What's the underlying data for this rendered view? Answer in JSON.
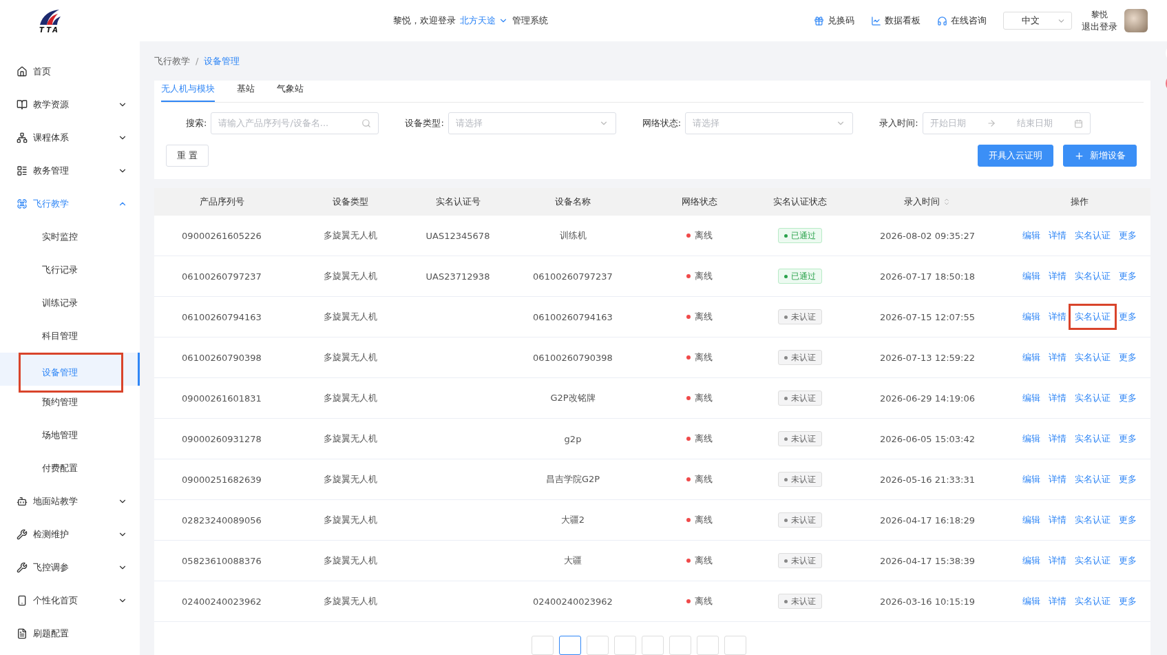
{
  "header": {
    "greeting": "黎悦，欢迎登录",
    "org": "北方天途",
    "system": "管理系统",
    "links": [
      {
        "kind": "gift",
        "label": "兑换码"
      },
      {
        "kind": "chart",
        "label": "数据看板"
      },
      {
        "kind": "headset",
        "label": "在线咨询"
      }
    ],
    "language": "中文",
    "user": "黎悦",
    "logout": "退出登录",
    "logo_text": "TTA"
  },
  "sidebar": [
    {
      "kind": "home",
      "label": "首页",
      "expandable": false,
      "expanded": false
    },
    {
      "kind": "book",
      "label": "教学资源",
      "expandable": true,
      "expanded": false
    },
    {
      "kind": "tree",
      "label": "课程体系",
      "expandable": true,
      "expanded": false
    },
    {
      "kind": "list",
      "label": "教务管理",
      "expandable": true,
      "expanded": false
    },
    {
      "kind": "drone",
      "label": "飞行教学",
      "expandable": true,
      "expanded": true,
      "children": [
        {
          "label": "实时监控",
          "selected": false,
          "highlighted": false
        },
        {
          "label": "飞行记录",
          "selected": false,
          "highlighted": false
        },
        {
          "label": "训练记录",
          "selected": false,
          "highlighted": false
        },
        {
          "label": "科目管理",
          "selected": false,
          "highlighted": false
        },
        {
          "label": "设备管理",
          "selected": true,
          "highlighted": true
        },
        {
          "label": "预约管理",
          "selected": false,
          "highlighted": false
        },
        {
          "label": "场地管理",
          "selected": false,
          "highlighted": false
        },
        {
          "label": "付费配置",
          "selected": false,
          "highlighted": false
        }
      ]
    },
    {
      "kind": "robot",
      "label": "地面站教学",
      "expandable": true,
      "expanded": false
    },
    {
      "kind": "tools",
      "label": "检测维护",
      "expandable": true,
      "expanded": false
    },
    {
      "kind": "tools",
      "label": "飞控调参",
      "expandable": true,
      "expanded": false
    },
    {
      "kind": "phone",
      "label": "个性化首页",
      "expandable": true,
      "expanded": false
    },
    {
      "kind": "doc",
      "label": "刷题配置",
      "expandable": false,
      "expanded": false
    }
  ],
  "breadcrumb": [
    "飞行教学",
    "设备管理"
  ],
  "breadcrumb_separator": "/",
  "tabs": [
    {
      "label": "无人机与模块",
      "selected": true
    },
    {
      "label": "基站",
      "selected": false
    },
    {
      "label": "气象站",
      "selected": false
    }
  ],
  "filters": [
    {
      "kind": "search",
      "label": "搜索:",
      "placeholder": "请输入产品序列号/设备名..."
    },
    {
      "kind": "select",
      "label": "设备类型:",
      "placeholder": "请选择"
    },
    {
      "kind": "select",
      "label": "网络状态:",
      "placeholder": "请选择"
    },
    {
      "kind": "daterange",
      "label": "录入时间:",
      "placeholder": "开始日期",
      "placeholder_end": "结束日期"
    }
  ],
  "reset_button": "重 置",
  "action_buttons": [
    {
      "kind": "plain",
      "label": "开具入云证明"
    },
    {
      "kind": "add",
      "label": "新增设备"
    }
  ],
  "table": {
    "columns": [
      {
        "label": "产品序列号",
        "sortable": false
      },
      {
        "label": "设备类型",
        "sortable": false
      },
      {
        "label": "实名认证号",
        "sortable": false
      },
      {
        "label": "设备名称",
        "sortable": false
      },
      {
        "label": "网络状态",
        "sortable": false
      },
      {
        "label": "实名认证状态",
        "sortable": false
      },
      {
        "label": "录入时间",
        "sortable": true
      },
      {
        "label": "操作",
        "sortable": false
      }
    ],
    "rows": [
      {
        "serial": "09000261605226",
        "type": "多旋翼无人机",
        "cert": "UAS12345678",
        "name": "训练机",
        "network": "离线",
        "auth": {
          "kind": "passed",
          "label": "已通过"
        },
        "time": "2026-08-02 09:35:27",
        "actions": [
          {
            "label": "编辑",
            "highlighted": false
          },
          {
            "label": "详情",
            "highlighted": false
          },
          {
            "label": "实名认证",
            "highlighted": false
          },
          {
            "label": "更多",
            "highlighted": false
          }
        ]
      },
      {
        "serial": "06100260797237",
        "type": "多旋翼无人机",
        "cert": "UAS23712938",
        "name": "06100260797237",
        "network": "离线",
        "auth": {
          "kind": "passed",
          "label": "已通过"
        },
        "time": "2026-07-17 18:50:18",
        "actions": [
          {
            "label": "编辑",
            "highlighted": false
          },
          {
            "label": "详情",
            "highlighted": false
          },
          {
            "label": "实名认证",
            "highlighted": false
          },
          {
            "label": "更多",
            "highlighted": false
          }
        ]
      },
      {
        "serial": "06100260794163",
        "type": "多旋翼无人机",
        "name": "06100260794163",
        "network": "离线",
        "auth": {
          "kind": "none",
          "label": "未认证"
        },
        "time": "2026-07-15 12:07:55",
        "actions": [
          {
            "label": "编辑",
            "highlighted": false
          },
          {
            "label": "详情",
            "highlighted": false
          },
          {
            "label": "实名认证",
            "highlighted": true
          },
          {
            "label": "更多",
            "highlighted": false
          }
        ]
      },
      {
        "serial": "06100260790398",
        "type": "多旋翼无人机",
        "name": "06100260790398",
        "network": "离线",
        "auth": {
          "kind": "none",
          "label": "未认证"
        },
        "time": "2026-07-13 12:59:22",
        "actions": [
          {
            "label": "编辑",
            "highlighted": false
          },
          {
            "label": "详情",
            "highlighted": false
          },
          {
            "label": "实名认证",
            "highlighted": false
          },
          {
            "label": "更多",
            "highlighted": false
          }
        ]
      },
      {
        "serial": "09000261601831",
        "type": "多旋翼无人机",
        "name": "G2P改铭牌",
        "network": "离线",
        "auth": {
          "kind": "none",
          "label": "未认证"
        },
        "time": "2026-06-29 14:19:06",
        "actions": [
          {
            "label": "编辑",
            "highlighted": false
          },
          {
            "label": "详情",
            "highlighted": false
          },
          {
            "label": "实名认证",
            "highlighted": false
          },
          {
            "label": "更多",
            "highlighted": false
          }
        ]
      },
      {
        "serial": "09000260931278",
        "type": "多旋翼无人机",
        "name": "g2p",
        "network": "离线",
        "auth": {
          "kind": "none",
          "label": "未认证"
        },
        "time": "2026-06-05 15:03:42",
        "actions": [
          {
            "label": "编辑",
            "highlighted": false
          },
          {
            "label": "详情",
            "highlighted": false
          },
          {
            "label": "实名认证",
            "highlighted": false
          },
          {
            "label": "更多",
            "highlighted": false
          }
        ]
      },
      {
        "serial": "09000251682639",
        "type": "多旋翼无人机",
        "name": "昌吉学院G2P",
        "network": "离线",
        "auth": {
          "kind": "none",
          "label": "未认证"
        },
        "time": "2026-05-16 21:33:31",
        "actions": [
          {
            "label": "编辑",
            "highlighted": false
          },
          {
            "label": "详情",
            "highlighted": false
          },
          {
            "label": "实名认证",
            "highlighted": false
          },
          {
            "label": "更多",
            "highlighted": false
          }
        ]
      },
      {
        "serial": "02823240089056",
        "type": "多旋翼无人机",
        "name": "大疆2",
        "network": "离线",
        "auth": {
          "kind": "none",
          "label": "未认证"
        },
        "time": "2026-04-17 16:18:29",
        "actions": [
          {
            "label": "编辑",
            "highlighted": false
          },
          {
            "label": "详情",
            "highlighted": false
          },
          {
            "label": "实名认证",
            "highlighted": false
          },
          {
            "label": "更多",
            "highlighted": false
          }
        ]
      },
      {
        "serial": "05823610088376",
        "type": "多旋翼无人机",
        "name": "大疆",
        "network": "离线",
        "auth": {
          "kind": "none",
          "label": "未认证"
        },
        "time": "2026-04-17 15:38:39",
        "actions": [
          {
            "label": "编辑",
            "highlighted": false
          },
          {
            "label": "详情",
            "highlighted": false
          },
          {
            "label": "实名认证",
            "highlighted": false
          },
          {
            "label": "更多",
            "highlighted": false
          }
        ]
      },
      {
        "serial": "02400240023962",
        "type": "多旋翼无人机",
        "name": "02400240023962",
        "network": "离线",
        "auth": {
          "kind": "none",
          "label": "未认证"
        },
        "time": "2026-03-16 10:15:19",
        "actions": [
          {
            "label": "编辑",
            "highlighted": false
          },
          {
            "label": "详情",
            "highlighted": false
          },
          {
            "label": "实名认证",
            "highlighted": false
          },
          {
            "label": "更多",
            "highlighted": false
          }
        ]
      }
    ]
  },
  "pagination": {
    "pages": [
      {
        "selected": false
      },
      {
        "selected": true
      },
      {
        "selected": false
      },
      {
        "selected": false
      },
      {
        "selected": false
      },
      {
        "selected": false
      },
      {
        "selected": false
      },
      {
        "selected": false
      }
    ]
  }
}
